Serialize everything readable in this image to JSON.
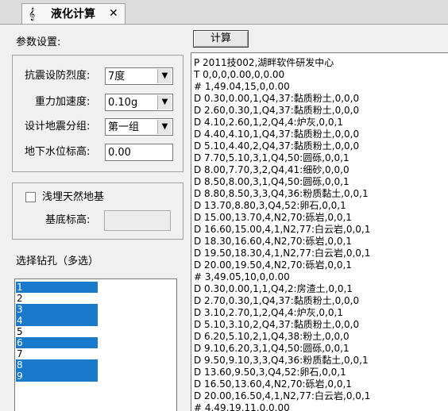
{
  "tab": {
    "icon": "music-note-icon",
    "title": "液化计算",
    "close": "✕"
  },
  "params": {
    "title": "参数设置:",
    "intensity": {
      "label": "抗震设防烈度:",
      "value": "7度"
    },
    "gravity": {
      "label": "重力加速度:",
      "value": "0.10g"
    },
    "group": {
      "label": "设计地震分组:",
      "value": "第一组"
    },
    "water": {
      "label": "地下水位标高:",
      "value": "0.00"
    }
  },
  "shallow": {
    "checkbox_label": "浅埋天然地基",
    "base_label": "基底标高:",
    "base_value": ""
  },
  "boreholes": {
    "title": "选择钻孔（多选）",
    "items": [
      {
        "label": "1",
        "selected": true
      },
      {
        "label": "2",
        "selected": false
      },
      {
        "label": "3",
        "selected": true
      },
      {
        "label": "4",
        "selected": true
      },
      {
        "label": "5",
        "selected": false
      },
      {
        "label": "6",
        "selected": true
      },
      {
        "label": "7",
        "selected": false
      },
      {
        "label": "8",
        "selected": true
      },
      {
        "label": "9",
        "selected": true
      }
    ]
  },
  "compute_button": "计算",
  "output_lines": [
    "P 2011技002,湖畔软件研发中心",
    "T 0,0,0,0.00,0,0.00",
    "# 1,49.04,15,0,0.00",
    "D 0.30,0.00,1,Q4,37:黏质粉土,0,0,0",
    "D 2.60,0.30,1,Q4,37:黏质粉土,0,0,0",
    "D 4.10,2.60,1,2,Q4,4:炉灰,0,0,1",
    "D 4.40,4.10,1,Q4,37:黏质粉土,0,0,0",
    "D 5.10,4.40,2,Q4,37:黏质粉土,0,0,0",
    "D 7.70,5.10,3,1,Q4,50:圆砾,0,0,1",
    "D 8.00,7.70,3,2,Q4,41:细砂,0,0,0",
    "D 8.50,8.00,3,1,Q4,50:圆砾,0,0,1",
    "D 8.80,8.50,3,3,Q4,36:粉质黏土,0,0,1",
    "D 13.70,8.80,3,Q4,52:卵石,0,0,1",
    "D 15.00,13.70,4,N2,70:砾岩,0,0,1",
    "D 16.60,15.00,4,1,N2,77:白云岩,0,0,1",
    "D 18.30,16.60,4,N2,70:砾岩,0,0,1",
    "D 19.50,18.30,4,1,N2,77:白云岩,0,0,1",
    "D 20.00,19.50,4,N2,70:砾岩,0,0,1",
    "# 3,49.05,10,0,0.00",
    "D 0.30,0.00,1,1,Q4,2:房渣土,0,0,1",
    "D 2.70,0.30,1,Q4,37:黏质粉土,0,0,0",
    "D 3.10,2.70,1,2,Q4,4:炉灰,0,0,1",
    "D 5.10,3.10,2,Q4,37:黏质粉土,0,0,0",
    "D 6.20,5.10,2,1,Q4,38:粉土,0,0,0",
    "D 9.10,6.20,3,1,Q4,50:圆砾,0,0,1",
    "D 9.50,9.10,3,3,Q4,36:粉质黏土,0,0,1",
    "D 13.60,9.50,3,Q4,52:卵石,0,0,1",
    "D 16.50,13.60,4,N2,70:砾岩,0,0,1",
    "D 20.00,16.50,4,1,N2,77:白云岩,0,0,1",
    "# 4,49.19,11,0,0.00"
  ]
}
